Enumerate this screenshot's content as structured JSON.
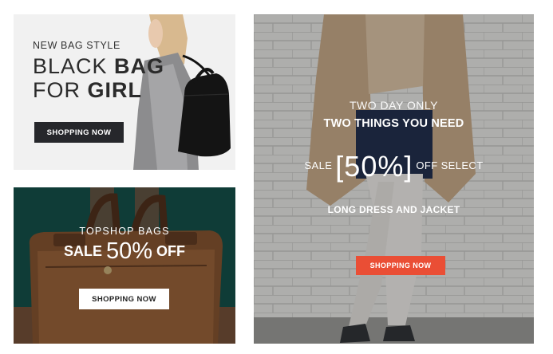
{
  "banners": {
    "black_bag": {
      "kicker": "NEW BAG STYLE",
      "line1_light": "BLACK ",
      "line1_bold": "BAG",
      "line2_light": "FOR ",
      "line2_bold": "GIRL",
      "button_label": "SHOPPING NOW",
      "button_color": "#26272b"
    },
    "topshop": {
      "kicker": "TOPSHOP BAGS",
      "sale_word": "SALE ",
      "percent": "50%",
      "off_word": " OFF",
      "button_label": "SHOPPING NOW",
      "button_color": "#ffffff"
    },
    "two_day": {
      "kicker": "TWO DAY ONLY",
      "title": "TWO THINGS YOU NEED",
      "sale_word": "SALE ",
      "percent": "[50%]",
      "off_select": " OFF SELECT",
      "subtitle": "LONG DRESS AND JACKET",
      "button_label": "SHOPPING NOW",
      "button_color": "#ea4e35"
    }
  }
}
